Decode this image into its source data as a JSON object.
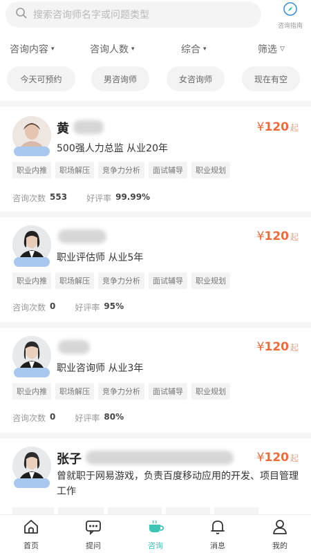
{
  "search": {
    "placeholder": "搜索咨询师名字或问题类型"
  },
  "guide": {
    "label": "咨询指南",
    "icon": "compass-icon"
  },
  "filters": [
    {
      "label": "咨询内容",
      "caret": "▾"
    },
    {
      "label": "咨询人数",
      "caret": "▾"
    },
    {
      "label": "综合",
      "caret": "▾"
    },
    {
      "label": "筛选",
      "caret": "▽"
    }
  ],
  "chips": [
    "今天可预约",
    "男咨询师",
    "女咨询师",
    "现在有空"
  ],
  "currency": "¥",
  "price_suffix": "起",
  "stats_labels": {
    "count": "咨询次数",
    "rate": "好评率"
  },
  "consultants": [
    {
      "name": "黄",
      "price": "120",
      "title": "500强人力总监 从业20年",
      "tags": [
        "职业内推",
        "职场解压",
        "竞争力分析",
        "面试辅导",
        "职业规划"
      ],
      "count": "553",
      "rate": "99.99%"
    },
    {
      "name": "",
      "price": "120",
      "title": "职业评估师 从业5年",
      "tags": [
        "职业内推",
        "职场解压",
        "竞争力分析",
        "面试辅导",
        "职业规划"
      ],
      "count": "0",
      "rate": "95%"
    },
    {
      "name": "",
      "price": "120",
      "title": "职业咨询师 从业3年",
      "tags": [
        "职业内推",
        "职场解压",
        "竞争力分析",
        "面试辅导",
        "职业规划"
      ],
      "count": "0",
      "rate": "80%"
    },
    {
      "name": "张子",
      "price": "120",
      "desc": "曾就职于网易游戏，负责百度移动应用的开发、项目管理工作"
    }
  ],
  "nav": [
    {
      "label": "首页",
      "icon": "home-icon"
    },
    {
      "label": "提问",
      "icon": "question-chat-icon"
    },
    {
      "label": "咨询",
      "icon": "consult-cup-icon",
      "active": true
    },
    {
      "label": "消息",
      "icon": "bell-icon"
    },
    {
      "label": "我的",
      "icon": "user-icon"
    }
  ],
  "colors": {
    "accent": "#3cc5b6",
    "price": "#ef6a3a",
    "badge": "#a9c8f0"
  }
}
